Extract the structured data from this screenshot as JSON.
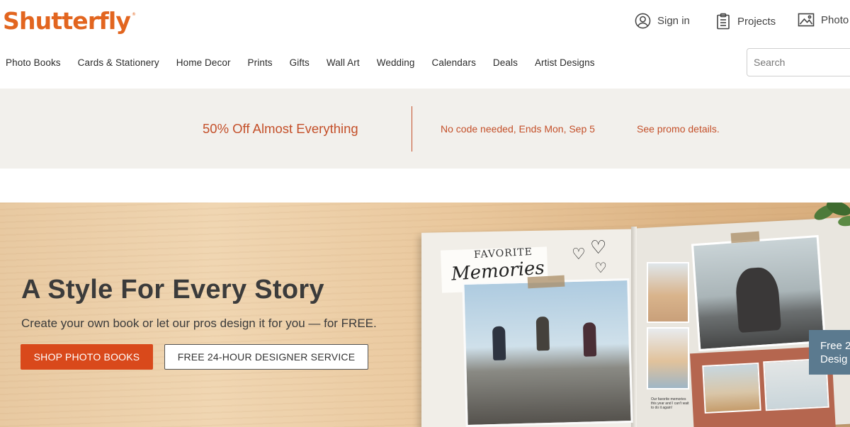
{
  "header": {
    "logo": "Shutterfly",
    "logo_mark": "®",
    "sign_in": "Sign in",
    "projects": "Projects",
    "photos": "Photo"
  },
  "icons": {
    "sign_in": "user-circle-icon",
    "projects": "clipboard-icon",
    "photos": "image-icon"
  },
  "nav": {
    "items": [
      {
        "label": "Photo Books"
      },
      {
        "label": "Cards & Stationery"
      },
      {
        "label": "Home Decor"
      },
      {
        "label": "Prints"
      },
      {
        "label": "Gifts"
      },
      {
        "label": "Wall Art"
      },
      {
        "label": "Wedding"
      },
      {
        "label": "Calendars"
      },
      {
        "label": "Deals"
      },
      {
        "label": "Artist Designs"
      }
    ],
    "search_placeholder": "Search"
  },
  "promo": {
    "headline": "50% Off Almost Everything",
    "subtext": "No code needed, Ends Mon, Sep 5",
    "link": "See promo details."
  },
  "hero": {
    "title": "A Style For Every Story",
    "subtitle": "Create your own book or let our pros design it for you — for FREE.",
    "primary_button": "SHOP PHOTO BOOKS",
    "secondary_button": "FREE 24-HOUR DESIGNER SERVICE",
    "book_text_1": "FAVORITE",
    "book_text_2": "Memories",
    "book_caption": "Our favorite memories this year and I can't wait to do it again!",
    "side_tab_line_1": "Free 2",
    "side_tab_line_2": "Desig"
  },
  "colors": {
    "brand": "#e2651f",
    "promo_text": "#c4502a",
    "promo_bg": "#f2f0ec",
    "cta": "#d9491b",
    "side_tab": "#5b7a8f"
  }
}
